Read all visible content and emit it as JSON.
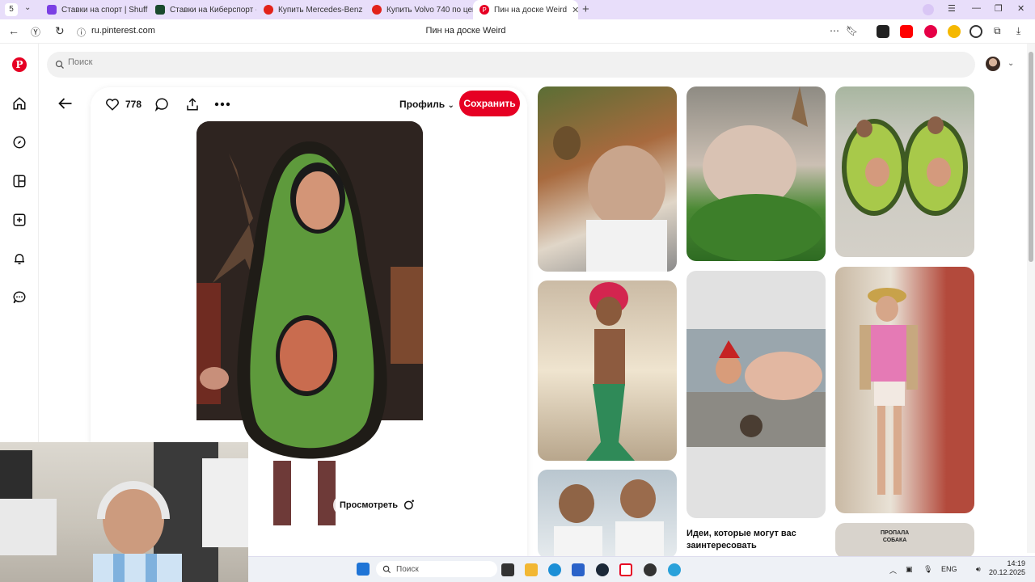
{
  "browser": {
    "tab_count": "5",
    "tabs": [
      {
        "label": "Ставки на спорт | Shuffle",
        "favicon_color": "#7b3fe4"
      },
      {
        "label": "Ставки на Киберспорт - С",
        "favicon_color": "#1a4a2e"
      },
      {
        "label": "Купить Mercedes-Benz по",
        "favicon_color": "#e2231a"
      },
      {
        "label": "Купить Volvo 740 по цене",
        "favicon_color": "#e2231a"
      },
      {
        "label": "Пин на доске Weird",
        "favicon_color": "#e60023"
      }
    ],
    "url": "ru.pinterest.com",
    "page_title": "Пин на доске Weird"
  },
  "search": {
    "placeholder": "Поиск"
  },
  "pin": {
    "likes": "778",
    "profile_label": "Профиль",
    "save_label": "Сохранить",
    "view_label": "Просмотреть"
  },
  "related": {
    "ideas_title": "Идеи, которые могут вас заинтересовать",
    "sign_text_line1": "ПРОПАЛА",
    "sign_text_line2": "СОБАКА"
  },
  "taskbar": {
    "search_placeholder": "Поиск",
    "lang": "ENG",
    "time": "14:19",
    "date": "20.12.2025"
  },
  "colors": {
    "pinterest_red": "#e60023",
    "tabstrip": "#e8defa"
  }
}
